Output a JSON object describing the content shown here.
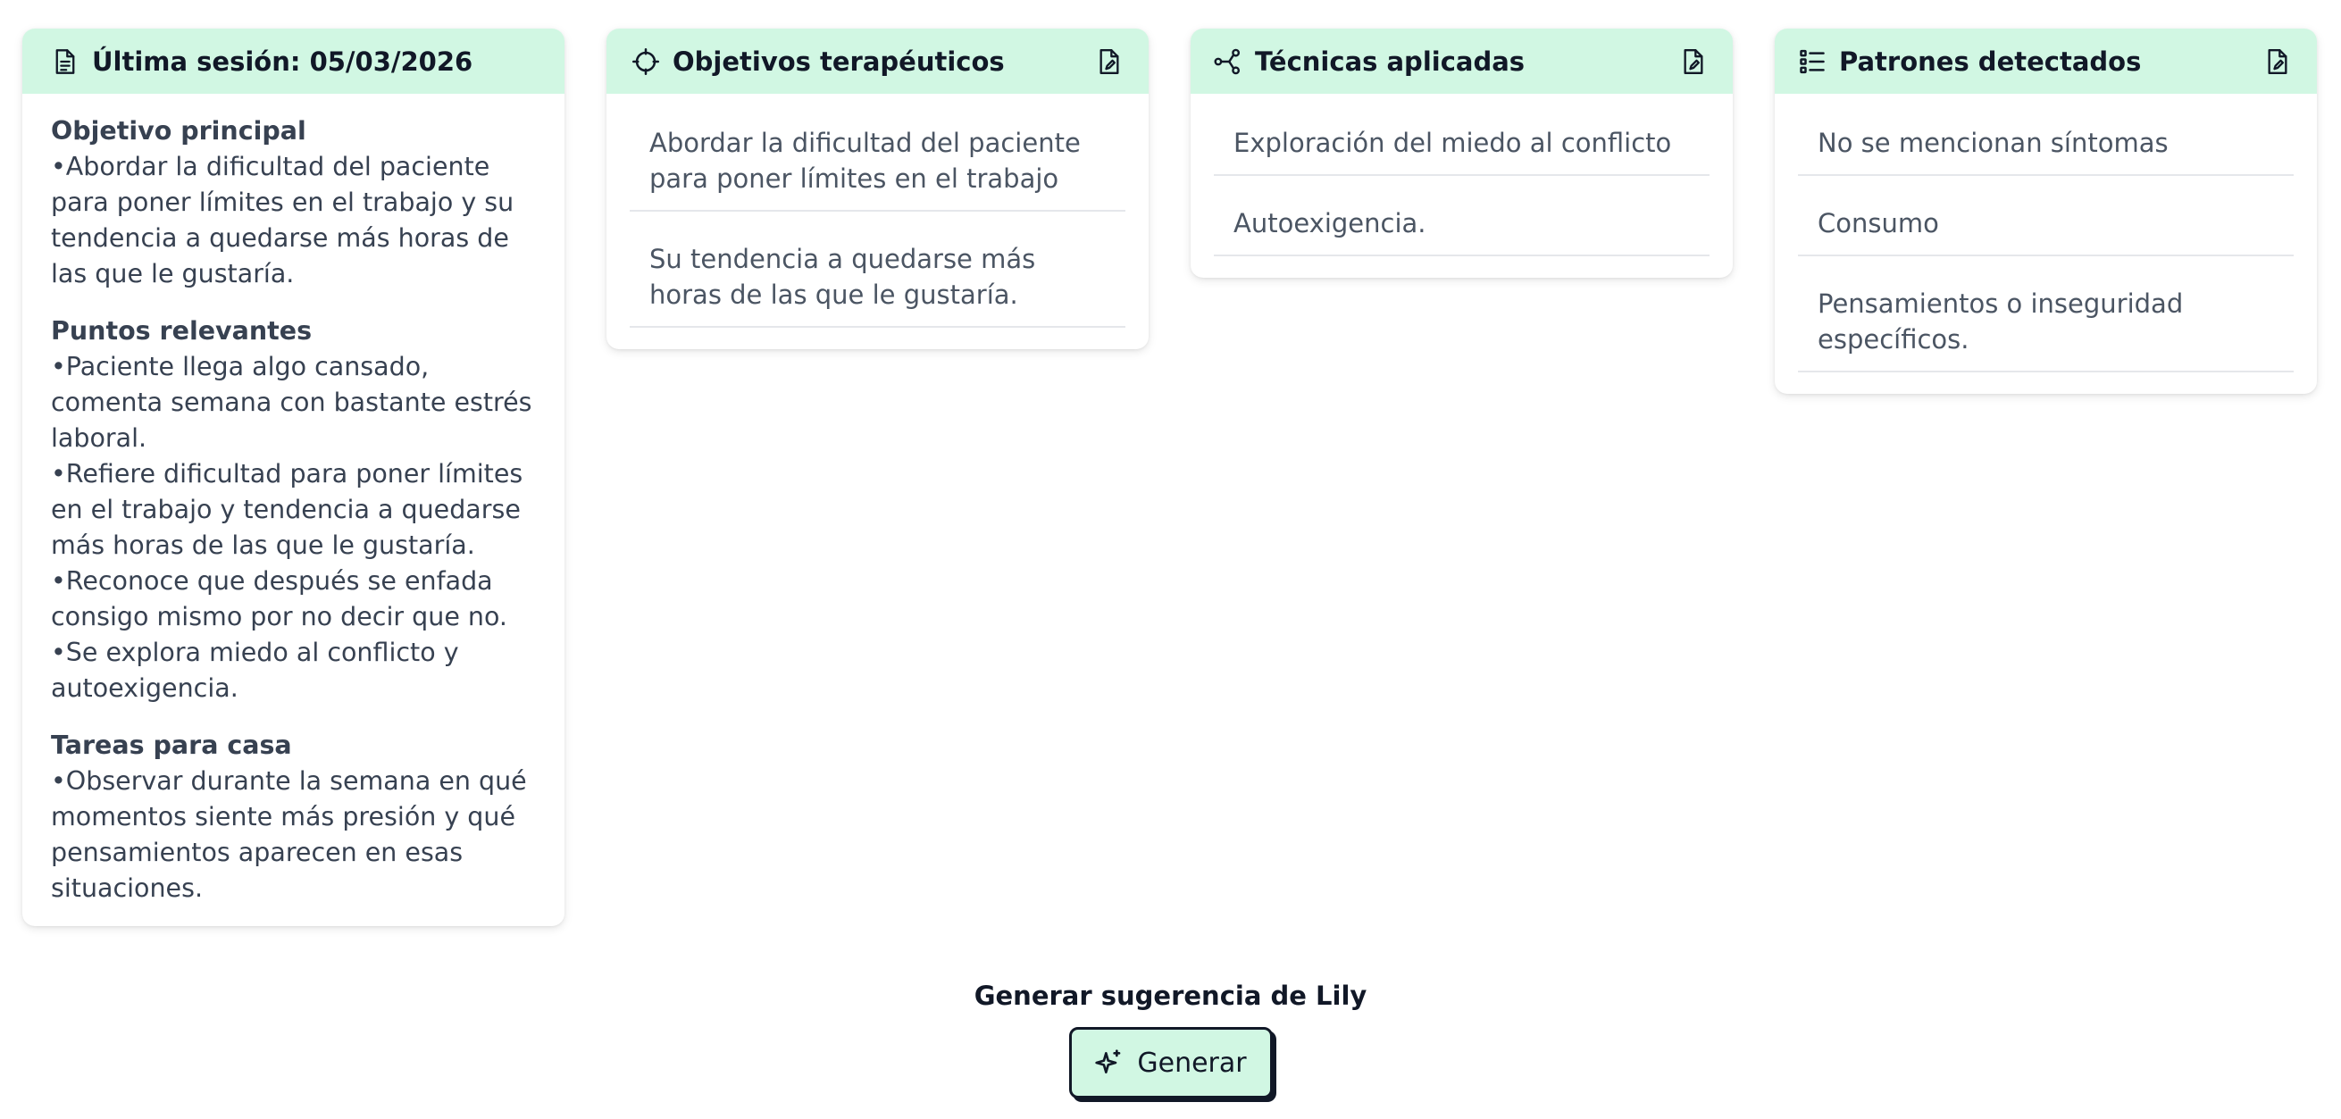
{
  "colors": {
    "header_bg": "#d1f7e3",
    "button_bg": "#d1f7e3",
    "text_dark": "#111827",
    "text_body": "#4b5563"
  },
  "summary_card": {
    "title": "Última sesión: 05/03/2026",
    "icon": "document-icon",
    "sections": [
      {
        "title": "Objetivo principal",
        "bullets": [
          "•Abordar la dificultad del paciente para poner límites en el trabajo y su tendencia a quedarse más horas de las que le gustaría."
        ]
      },
      {
        "title": "Puntos relevantes",
        "bullets": [
          "•Paciente llega algo cansado, comenta semana con bastante estrés laboral.",
          "•Refiere dificultad para poner límites en el trabajo y tendencia a quedarse más horas de las que le gustaría.",
          "•Reconoce que después se enfada consigo mismo por no decir que no.",
          "•Se explora miedo al conflicto y autoexigencia."
        ]
      },
      {
        "title": "Tareas para casa",
        "bullets": [
          "•Observar durante la semana en qué momentos siente más presión y qué pensamientos aparecen en esas situaciones."
        ]
      }
    ]
  },
  "objectives_card": {
    "title": "Objetivos terapéuticos",
    "icon": "crosshair-icon",
    "items": [
      "Abordar la dificultad del paciente para poner límites en el trabajo",
      "Su tendencia a quedarse más horas de las que le gustaría."
    ]
  },
  "techniques_card": {
    "title": "Técnicas aplicadas",
    "icon": "share-nodes-icon",
    "items": [
      "Exploración del miedo al conflicto",
      "Autoexigencia."
    ]
  },
  "patterns_card": {
    "title": "Patrones detectados",
    "icon": "list-check-icon",
    "items": [
      "No se mencionan síntomas",
      "Consumo",
      "Pensamientos o inseguridad específicos."
    ]
  },
  "lily": {
    "title": "Generar sugerencia de Lily",
    "button_label": "Generar",
    "button_icon": "sparkles-icon"
  }
}
